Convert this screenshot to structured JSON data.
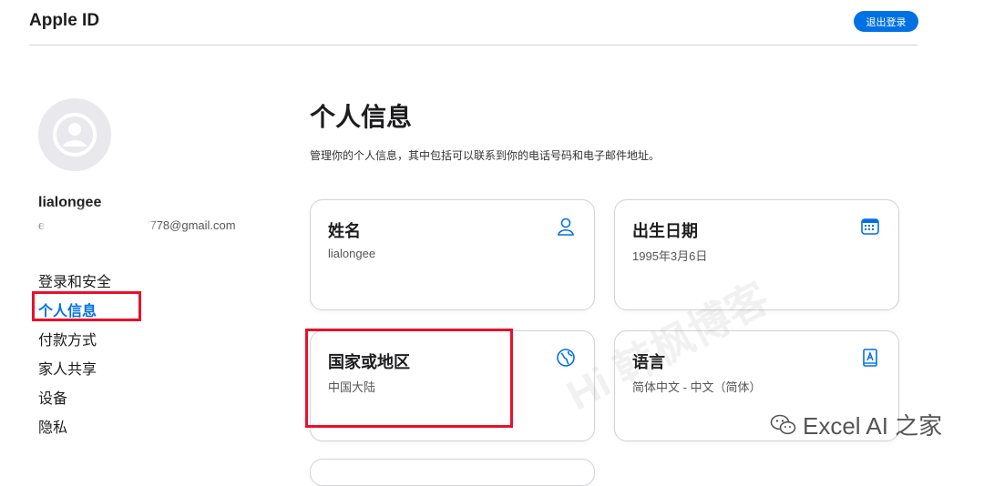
{
  "header": {
    "title": "Apple ID",
    "signout_label": "退出登录"
  },
  "profile": {
    "name": "lialongee",
    "email_prefix": "e",
    "email_suffix": "7778@gmail.com"
  },
  "sidebar": {
    "items": [
      {
        "label": "登录和安全",
        "active": false
      },
      {
        "label": "个人信息",
        "active": true
      },
      {
        "label": "付款方式",
        "active": false
      },
      {
        "label": "家人共享",
        "active": false
      },
      {
        "label": "设备",
        "active": false
      },
      {
        "label": "隐私",
        "active": false
      }
    ]
  },
  "main": {
    "title": "个人信息",
    "description": "管理你的个人信息，其中包括可以联系到你的电话号码和电子邮件地址。",
    "cards": [
      {
        "title": "姓名",
        "value": "lialongee",
        "icon": "person-icon"
      },
      {
        "title": "出生日期",
        "value": "1995年3月6日",
        "icon": "calendar-icon"
      },
      {
        "title": "国家或地区",
        "value": "中国大陆",
        "icon": "globe-icon"
      },
      {
        "title": "语言",
        "value": "简体中文 - 中文（简体）",
        "icon": "language-book-icon"
      }
    ]
  },
  "watermark": {
    "text": "Excel AI 之家",
    "faint_text": "Hi 韩枫博客"
  },
  "colors": {
    "accent": "#0071e3",
    "annotation": "#e8102a"
  }
}
